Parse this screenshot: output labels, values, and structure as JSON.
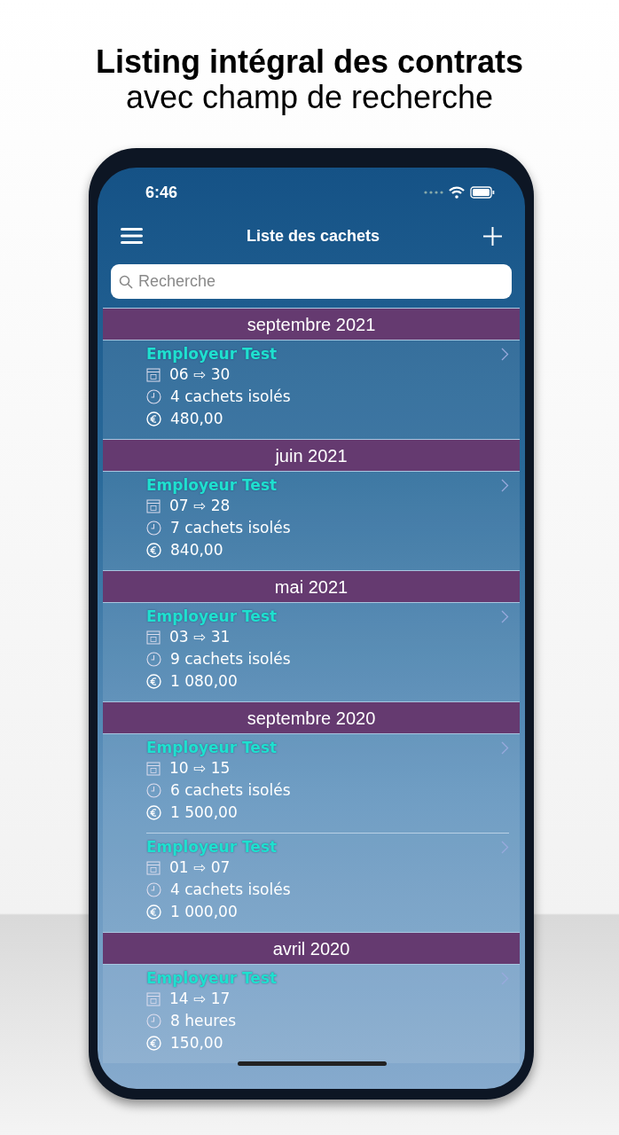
{
  "headline": {
    "title": "Listing intégral des contrats",
    "subtitle": "avec champ de recherche"
  },
  "status_bar": {
    "time": "6:46"
  },
  "nav_bar": {
    "title": "Liste des cachets"
  },
  "search": {
    "placeholder": "Recherche"
  },
  "sections": [
    {
      "title": "septembre 2021",
      "items": [
        {
          "employer": "Employeur Test",
          "dates": "06 ⇨ 30",
          "quantity": "4 cachets isolés",
          "amount": "480,00"
        }
      ]
    },
    {
      "title": "juin 2021",
      "items": [
        {
          "employer": "Employeur Test",
          "dates": "07 ⇨ 28",
          "quantity": "7 cachets isolés",
          "amount": "840,00"
        }
      ]
    },
    {
      "title": "mai 2021",
      "items": [
        {
          "employer": "Employeur Test",
          "dates": "03 ⇨ 31",
          "quantity": "9 cachets isolés",
          "amount": "1 080,00"
        }
      ]
    },
    {
      "title": "septembre 2020",
      "items": [
        {
          "employer": "Employeur Test",
          "dates": "10 ⇨ 15",
          "quantity": "6 cachets isolés",
          "amount": "1 500,00"
        },
        {
          "employer": "Employeur Test",
          "dates": "01 ⇨ 07",
          "quantity": "4 cachets isolés",
          "amount": "1 000,00"
        }
      ]
    },
    {
      "title": "avril 2020",
      "items": [
        {
          "employer": "Employeur Test",
          "dates": "14 ⇨ 17",
          "quantity": "8 heures",
          "amount": "150,00"
        }
      ]
    }
  ]
}
